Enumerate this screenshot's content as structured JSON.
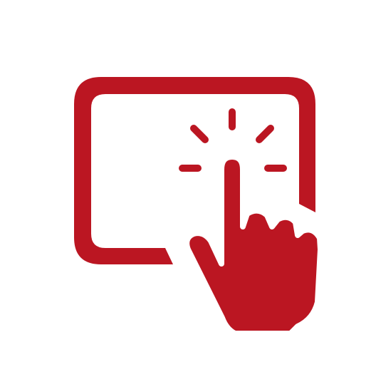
{
  "icon": {
    "name": "touch-screen-tap-icon",
    "color": "#bb1622"
  }
}
